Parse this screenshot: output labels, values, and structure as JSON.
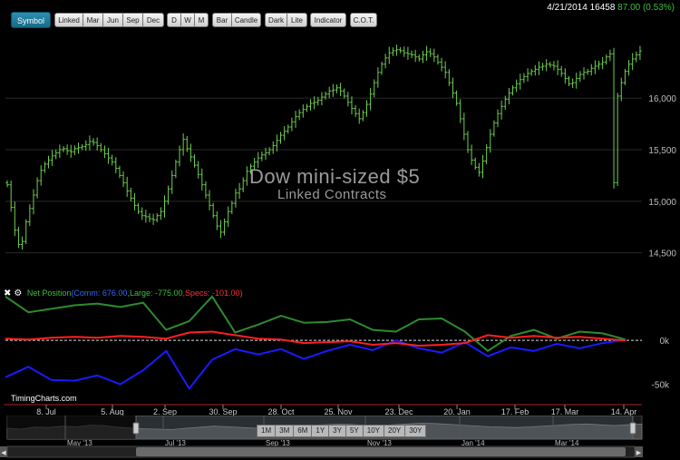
{
  "toolbar": {
    "symbol": "Symbol",
    "contracts": [
      "Linked",
      "Mar",
      "Jun",
      "Sep",
      "Dec"
    ],
    "periods": [
      "D",
      "W",
      "M"
    ],
    "styles": [
      "Bar",
      "Candle"
    ],
    "themes": [
      "Dark",
      "Lite"
    ],
    "indicator": "Indicator",
    "cot": "C.O.T."
  },
  "quote": {
    "date": "4/21/2014",
    "price": "16458",
    "change": "87.00 (0.53%)"
  },
  "watermark": {
    "title": "Dow mini-sized $5",
    "subtitle": "Linked Contracts"
  },
  "price_axis": [
    "16,000",
    "15,500",
    "15,000",
    "14,500"
  ],
  "cot_legend": {
    "title": "Net Position",
    "comm": "Comm: 676.00",
    "large": "Large: -775.00",
    "specs": "Specs: -101.00"
  },
  "cot_axis": [
    "0k",
    "-50k"
  ],
  "site": "TimingCharts.com",
  "date_axis": [
    "8. Jul",
    "5. Aug",
    "2. Sep",
    "30. Sep",
    "28. Oct",
    "25. Nov",
    "23. Dec",
    "20. Jan",
    "17. Feb",
    "17. Mar",
    "14. Apr"
  ],
  "range_buttons": [
    "1M",
    "3M",
    "6M",
    "1Y",
    "3Y",
    "5Y",
    "10Y",
    "20Y",
    "30Y"
  ],
  "navigator_axis": [
    "May '13",
    "Jul '13",
    "Sep '13",
    "Nov '13",
    "Jan '14",
    "Mar '14"
  ],
  "colors": {
    "price_bars": "#6fcf4f",
    "comm": "#1a1aff",
    "large": "#2e8b2e",
    "specs": "#ff2020"
  },
  "chart_data": [
    {
      "type": "ohlc",
      "y_ticks": [
        14500,
        15000,
        15500,
        16000
      ],
      "ylim": [
        14400,
        16600
      ],
      "x_ticks": [
        "8. Jul",
        "5. Aug",
        "2. Sep",
        "30. Sep",
        "28. Oct",
        "25. Nov",
        "23. Dec",
        "20. Jan",
        "17. Feb",
        "17. Mar",
        "14. Apr"
      ],
      "close": [
        15160,
        14940,
        14720,
        14580,
        14610,
        14800,
        14930,
        15060,
        15200,
        15300,
        15360,
        15400,
        15440,
        15470,
        15500,
        15510,
        15490,
        15480,
        15510,
        15520,
        15530,
        15550,
        15580,
        15570,
        15540,
        15500,
        15460,
        15420,
        15380,
        15320,
        15250,
        15180,
        15100,
        15030,
        14960,
        14900,
        14860,
        14850,
        14830,
        14820,
        14860,
        14900,
        15000,
        15120,
        15250,
        15380,
        15500,
        15600,
        15510,
        15430,
        15350,
        15260,
        15160,
        15060,
        14960,
        14860,
        14760,
        14700,
        14800,
        14900,
        14980,
        15080,
        15120,
        15200,
        15290,
        15340,
        15380,
        15420,
        15450,
        15470,
        15500,
        15540,
        15590,
        15640,
        15680,
        15720,
        15770,
        15820,
        15860,
        15890,
        15920,
        15950,
        15960,
        15980,
        16010,
        16040,
        16070,
        16080,
        16100,
        16070,
        16020,
        15960,
        15900,
        15850,
        15800,
        15860,
        15940,
        16040,
        16150,
        16250,
        16330,
        16390,
        16440,
        16460,
        16470,
        16460,
        16440,
        16430,
        16420,
        16400,
        16380,
        16420,
        16450,
        16430,
        16400,
        16350,
        16300,
        16250,
        16150,
        16050,
        15950,
        15800,
        15650,
        15500,
        15400,
        15330,
        15280,
        15390,
        15520,
        15650,
        15760,
        15850,
        15920,
        15990,
        16050,
        16100,
        16140,
        16180,
        16210,
        16240,
        16260,
        16280,
        16300,
        16310,
        16330,
        16320,
        16310,
        16280,
        16240,
        16190,
        16140,
        16150,
        16190,
        16230,
        16250,
        16260,
        16290,
        16310,
        16330,
        16350,
        16400,
        16430,
        15180,
        16020,
        16150,
        16260,
        16330,
        16380,
        16420,
        16458
      ]
    },
    {
      "type": "line",
      "y_ticks": [
        0,
        -50000
      ],
      "ylim": [
        -65000,
        55000
      ],
      "series": [
        {
          "color": "#2e8b2e",
          "values": [
            50000,
            32000,
            36000,
            40000,
            42000,
            38000,
            43000,
            12000,
            22000,
            50000,
            9000,
            18000,
            28000,
            20000,
            21000,
            24000,
            12000,
            10000,
            24000,
            25000,
            10000,
            -12000,
            5000,
            12000,
            2000,
            10000,
            8000,
            1000
          ]
        },
        {
          "color": "#1a1aff",
          "values": [
            -42000,
            -30000,
            -45000,
            -46000,
            -40000,
            -50000,
            -34000,
            -12000,
            -55000,
            -22000,
            -10000,
            -16000,
            -10000,
            -21000,
            -12000,
            -5000,
            -11000,
            0,
            -9000,
            -14000,
            -2000,
            -18000,
            -8000,
            -12000,
            -4000,
            -9000,
            -3000,
            676
          ]
        },
        {
          "color": "#ff2020",
          "values": [
            2000,
            1000,
            3000,
            4000,
            3000,
            5000,
            4000,
            2000,
            9000,
            10000,
            6000,
            2000,
            1000,
            -3000,
            -2000,
            -1000,
            -5000,
            -3000,
            -6000,
            -5000,
            -3000,
            6000,
            3000,
            5000,
            3000,
            4000,
            2000,
            -101
          ]
        }
      ]
    }
  ]
}
